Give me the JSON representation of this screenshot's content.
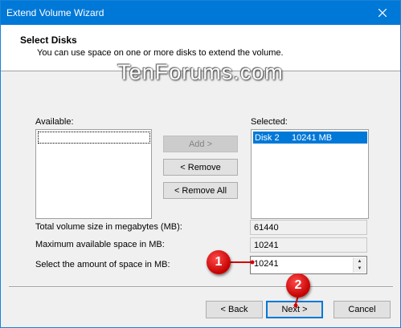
{
  "window": {
    "title": "Extend Volume Wizard"
  },
  "header": {
    "title": "Select Disks",
    "subtitle": "You can use space on one or more disks to extend the volume."
  },
  "watermark": "TenForums.com",
  "available": {
    "label": "Available:"
  },
  "selected": {
    "label": "Selected:",
    "items": [
      {
        "disk": "Disk 2",
        "size": "10241 MB"
      }
    ]
  },
  "buttons": {
    "add": "Add >",
    "remove": "< Remove",
    "remove_all": "< Remove All",
    "back": "< Back",
    "next": "Next >",
    "cancel": "Cancel"
  },
  "fields": {
    "total_label": "Total volume size in megabytes (MB):",
    "total_value": "61440",
    "max_label": "Maximum available space in MB:",
    "max_value": "10241",
    "amount_label": "Select the amount of space in MB:",
    "amount_value": "10241"
  },
  "callouts": {
    "first": "1",
    "second": "2"
  },
  "colors": {
    "titlebar": "#0078d7",
    "selection": "#0078d7",
    "callout": "#d40000"
  }
}
